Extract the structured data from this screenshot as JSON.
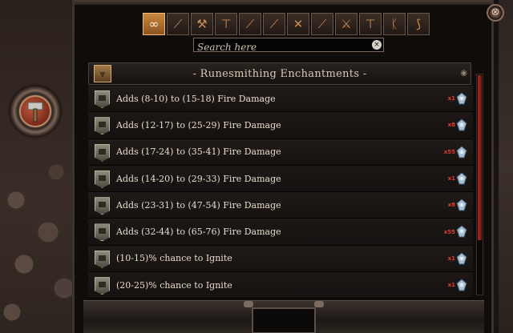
{
  "close_label": "⊗",
  "search": {
    "placeholder": "Search here",
    "clear_label": "×"
  },
  "filters": [
    {
      "icon": "infinity-icon",
      "glyph": "∞",
      "active": true
    },
    {
      "icon": "dagger-icon",
      "glyph": "⟋",
      "active": false
    },
    {
      "icon": "axe-icon",
      "glyph": "⚒",
      "active": false
    },
    {
      "icon": "hammer-icon",
      "glyph": "⊤",
      "active": false
    },
    {
      "icon": "wand-icon",
      "glyph": "⟋",
      "active": false
    },
    {
      "icon": "sword-icon",
      "glyph": "⟋",
      "active": false
    },
    {
      "icon": "twin-blade-icon",
      "glyph": "✕",
      "active": false
    },
    {
      "icon": "long-sword-icon",
      "glyph": "⟋",
      "active": false
    },
    {
      "icon": "great-axe-icon",
      "glyph": "⚔",
      "active": false
    },
    {
      "icon": "maul-icon",
      "glyph": "⊤",
      "active": false
    },
    {
      "icon": "scepter-icon",
      "glyph": "ᛕ",
      "active": false
    },
    {
      "icon": "bow-icon",
      "glyph": "⟆",
      "active": false
    }
  ],
  "header": {
    "title": "- Runesmithing Enchantments -",
    "badge_glyph": "⩔",
    "scroll_glyph": "◉"
  },
  "enchantments": [
    {
      "text": "Adds (8-10) to (15-18) Fire Damage",
      "count": "x1"
    },
    {
      "text": "Adds (12-17) to (25-29) Fire Damage",
      "count": "x8"
    },
    {
      "text": "Adds (17-24) to (35-41) Fire Damage",
      "count": "x55"
    },
    {
      "text": "Adds (14-20) to (29-33) Fire Damage",
      "count": "x1"
    },
    {
      "text": "Adds (23-31) to (47-54) Fire Damage",
      "count": "x8"
    },
    {
      "text": "Adds (32-44) to (65-76) Fire Damage",
      "count": "x55"
    },
    {
      "text": "(10-15)% chance to Ignite",
      "count": "x1"
    },
    {
      "text": "(20-25)% chance to Ignite",
      "count": "x1"
    }
  ],
  "colors": {
    "accent_orange": "#c98a3c",
    "count_red": "#e43a2a",
    "text_light": "#e8dccb",
    "scroll_red": "#a62a1c"
  }
}
